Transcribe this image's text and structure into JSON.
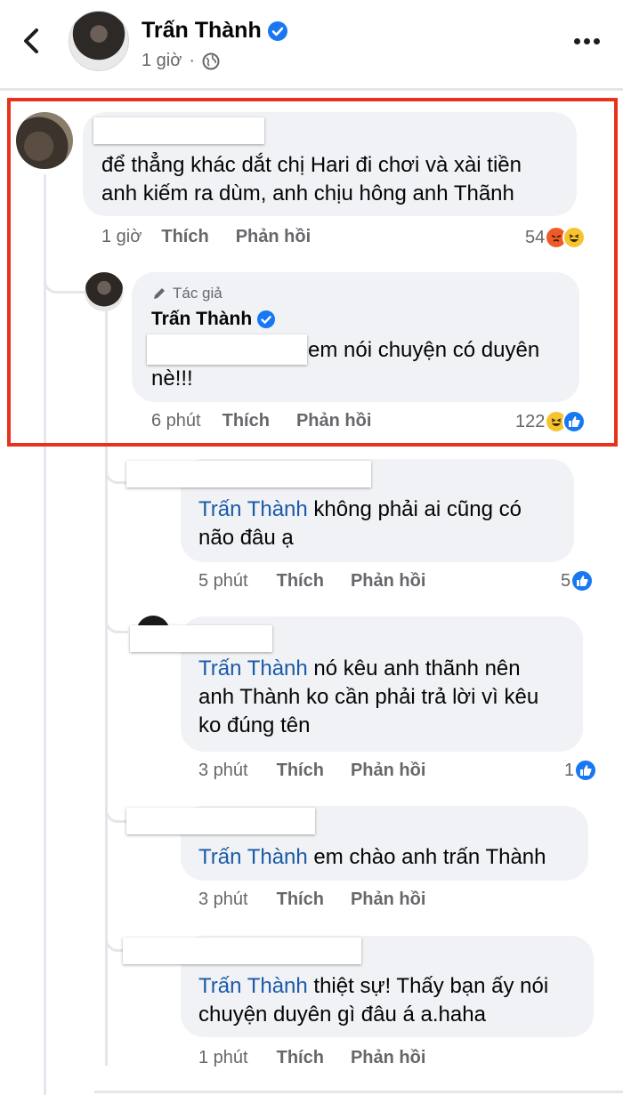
{
  "header": {
    "name": "Trấn Thành",
    "time": "1 giờ"
  },
  "comments": [
    {
      "text": "để thẳng khác dắt chị Hari đi chơi và xài tiền anh kiếm ra dùm, anh chịu hông anh Thãnh",
      "line1": "để thẳng khác dắt chị Hari đi chơi và xài tiền",
      "line2": "anh kiếm ra dùm, anh chịu hông anh Thãnh",
      "time": "1 giờ",
      "like_label": "Thích",
      "reply_label": "Phản hồi",
      "reactions": "54",
      "reaction_icons": [
        "angry-icon",
        "haha-icon"
      ]
    }
  ],
  "author_reply": {
    "badge": "Tác giả",
    "name": "Trấn Thành",
    "line1": "em nói chuyện có duyên",
    "line2": "nè!!!",
    "time": "6 phút",
    "like_label": "Thích",
    "reply_label": "Phản hồi",
    "reactions": "122",
    "reaction_icons": [
      "haha-icon",
      "like-icon"
    ]
  },
  "replies": [
    {
      "tag": "Trấn Thành",
      "line1": " không phải ai cũng có",
      "line2": "não đâu ạ",
      "time": "5 phút",
      "like_label": "Thích",
      "reply_label": "Phản hồi",
      "reactions": "5"
    },
    {
      "tag": "Trấn Thành",
      "line1": " nó kêu anh thãnh nên",
      "line2": "anh Thành ko cần phải trả lời vì kêu",
      "line3": "ko đúng tên",
      "time": "3 phút",
      "like_label": "Thích",
      "reply_label": "Phản hồi",
      "reactions": "1"
    },
    {
      "tag": "Trấn Thành",
      "line1": " em chào anh trấn Thành",
      "time": "3 phút",
      "like_label": "Thích",
      "reply_label": "Phản hồi"
    },
    {
      "tag": "Trấn Thành",
      "line1": " thiệt sự! Thấy bạn ấy nói",
      "line2": "chuyện duyên gì đâu á a.haha",
      "time": "1 phút",
      "like_label": "Thích",
      "reply_label": "Phản hồi"
    }
  ],
  "colors": {
    "highlight": "#e8321e",
    "tag": "#1b5aa8",
    "like_reaction": "#1877f2",
    "verified": "#1877f2"
  }
}
